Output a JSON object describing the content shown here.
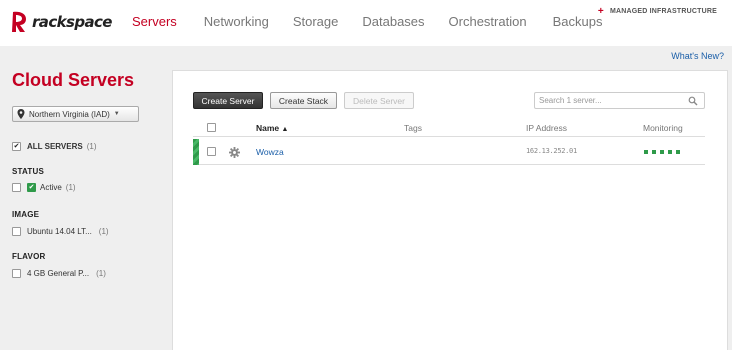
{
  "brand": {
    "name": "rackspace"
  },
  "nav": {
    "items": [
      "Servers",
      "Networking",
      "Storage",
      "Databases",
      "Orchestration",
      "Backups"
    ],
    "active": "Servers"
  },
  "managed": {
    "label": "MANAGED INFRASTRUCTURE"
  },
  "whats_new": "What's New?",
  "page_title": "Cloud Servers",
  "region": {
    "selected": "Northern Virginia (IAD)"
  },
  "filters": {
    "all_servers": {
      "label": "ALL SERVERS",
      "count": "(1)"
    },
    "status": {
      "heading": "STATUS",
      "label": "Active",
      "count": "(1)"
    },
    "image": {
      "heading": "IMAGE",
      "label": "Ubuntu 14.04 LT...",
      "count": "(1)"
    },
    "flavor": {
      "heading": "FLAVOR",
      "label": "4 GB General P...",
      "count": "(1)"
    }
  },
  "toolbar": {
    "create_server": "Create Server",
    "create_stack": "Create Stack",
    "delete_server": "Delete Server",
    "search_placeholder": "Search 1 server..."
  },
  "table": {
    "headers": {
      "name": "Name",
      "tags": "Tags",
      "ip": "IP Address",
      "monitoring": "Monitoring"
    },
    "rows": [
      {
        "name": "Wowza",
        "tags": "",
        "ip": "162.13.252.01",
        "monitoring_dots": 5
      }
    ]
  },
  "colors": {
    "brand_red": "#c40022",
    "link_blue": "#1a5ea8",
    "status_green": "#2f9a4a"
  }
}
